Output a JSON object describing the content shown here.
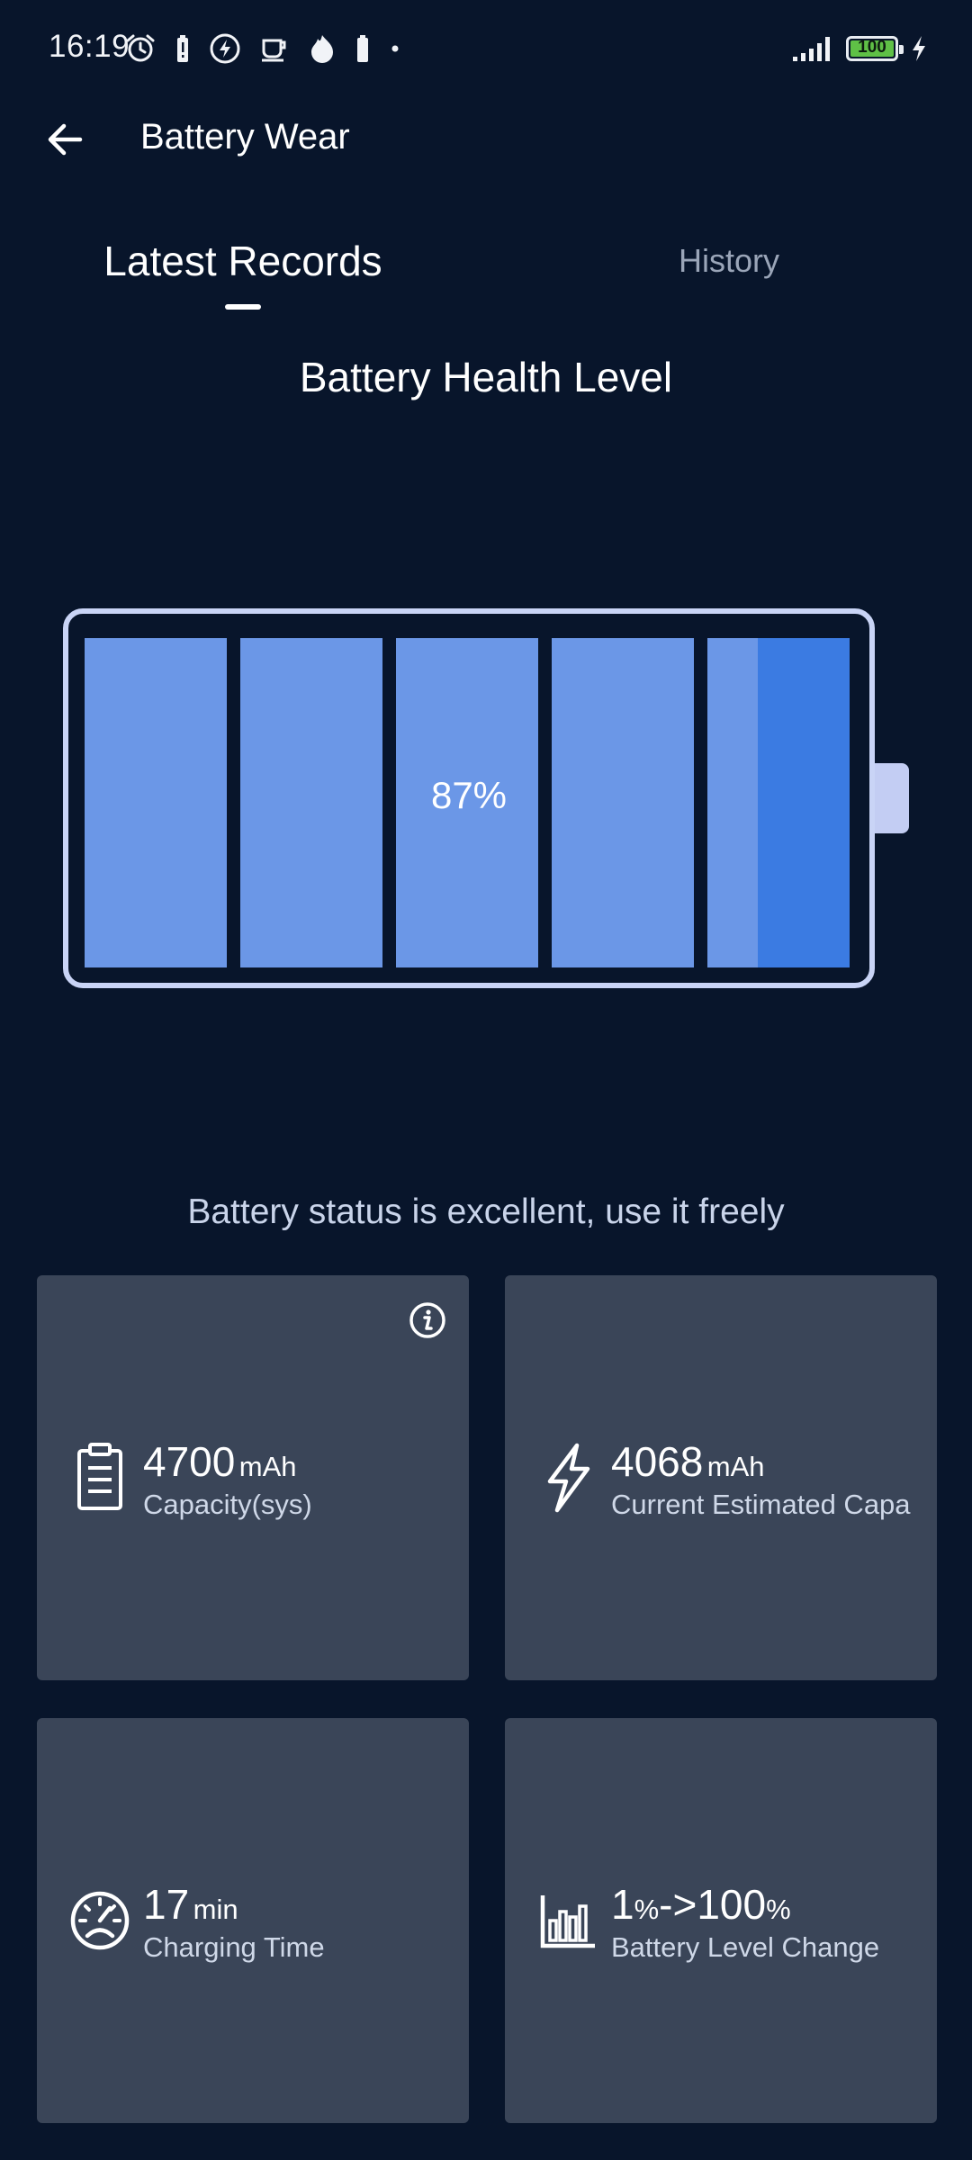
{
  "status_bar": {
    "time": "16:19",
    "battery_level": "100",
    "icons": [
      "alarm-icon",
      "battery-alert-icon",
      "charging-bolt-icon",
      "coffee-icon",
      "flame-icon",
      "battery-icon",
      "dot-icon",
      "signal-icon",
      "battery-indicator-icon",
      "charging-icon"
    ]
  },
  "app_bar": {
    "title": "Battery Wear",
    "back_icon": "back-arrow-icon"
  },
  "tabs": [
    {
      "label": "Latest Records",
      "active": true
    },
    {
      "label": "History",
      "active": false
    }
  ],
  "health": {
    "title": "Battery Health Level",
    "percent_text": "87%",
    "level": 0.87
  },
  "status_message": "Battery status is excellent, use it freely",
  "cards": [
    {
      "icon": "clipboard-icon",
      "value": "4700",
      "unit": "mAh",
      "label": "Capacity(sys)",
      "has_info": true
    },
    {
      "icon": "lightning-icon",
      "value": "4068",
      "unit": "mAh",
      "label": "Current Estimated Capa",
      "has_info": false
    },
    {
      "icon": "speedometer-icon",
      "value": "17",
      "unit": "min",
      "label": "Charging Time",
      "has_info": false
    },
    {
      "icon": "bar-chart-icon",
      "value_parts": [
        "1",
        "%",
        "->100",
        "%"
      ],
      "label": "Battery Level Change",
      "has_info": false
    }
  ],
  "colors": {
    "background": "#08152b",
    "card": "#3a4558",
    "cell": "#6b97e7",
    "cell_accent": "#3b7be2",
    "battery_outline": "#c9d4f6",
    "status_battery_green": "#5fc046"
  }
}
